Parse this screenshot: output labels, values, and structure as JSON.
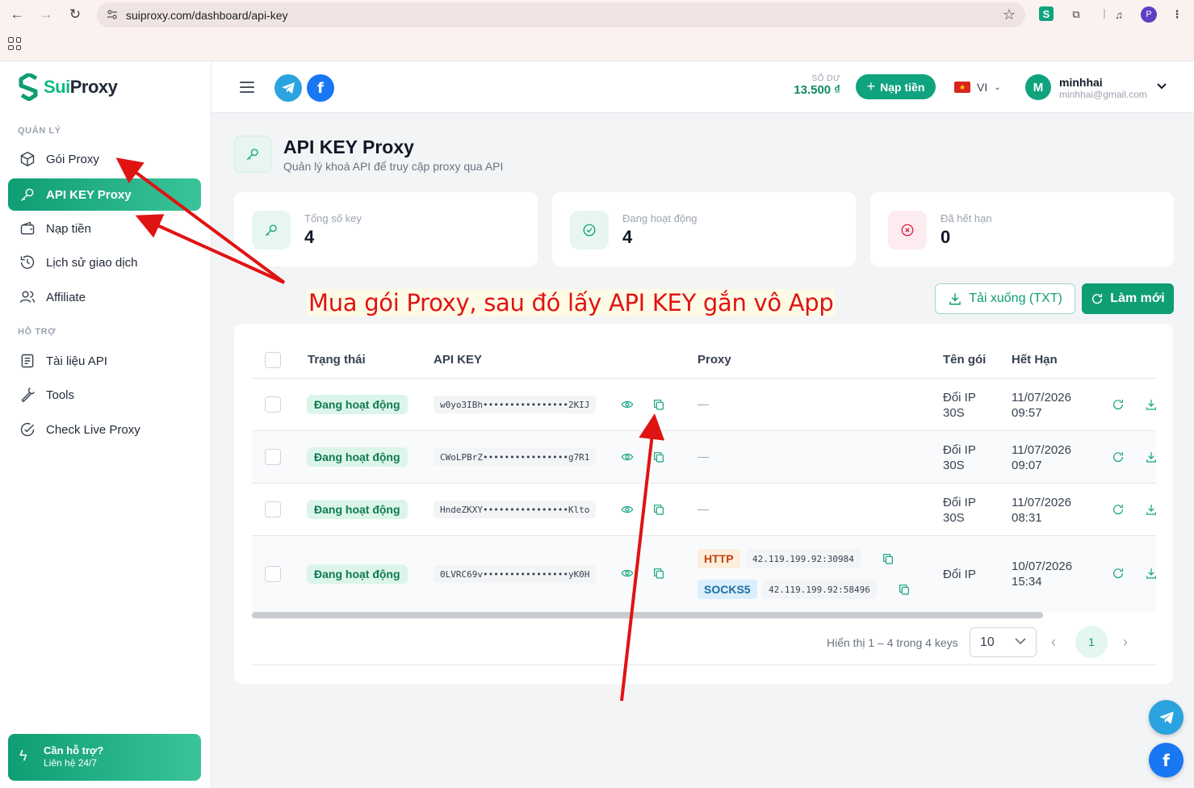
{
  "browser": {
    "url": "suiproxy.com/dashboard/api-key",
    "profile_initial": "P"
  },
  "sidebar": {
    "logo_part1": "Sui",
    "logo_part2": "Proxy",
    "section_manage": "QUẢN LÝ",
    "section_support": "HỖ TRỢ",
    "items": [
      {
        "label": "Gói Proxy",
        "icon": "box-icon"
      },
      {
        "label": "API KEY Proxy",
        "icon": "key-icon"
      },
      {
        "label": "Nạp tiền",
        "icon": "wallet-icon"
      },
      {
        "label": "Lịch sử giao dịch",
        "icon": "history-icon"
      },
      {
        "label": "Affiliate",
        "icon": "users-icon"
      },
      {
        "label": "Tài liệu API",
        "icon": "doc-icon"
      },
      {
        "label": "Tools",
        "icon": "wrench-icon"
      },
      {
        "label": "Check Live Proxy",
        "icon": "check-circle-icon"
      }
    ],
    "support_title": "Cần hỗ trợ?",
    "support_sub": "Liên hệ 24/7"
  },
  "header": {
    "balance_label": "SỐ DƯ",
    "balance_value": "13.500 ₫",
    "deposit_label": "Nạp tiền",
    "lang": "VI",
    "user_initial": "M",
    "user_name": "minhhai",
    "user_email": "minhhai@gmail.com"
  },
  "page": {
    "title": "API KEY Proxy",
    "subtitle": "Quản lý khoá API để truy cập proxy qua API"
  },
  "stats": [
    {
      "label": "Tổng số key",
      "value": "4",
      "color": "#10a37f"
    },
    {
      "label": "Đang hoạt động",
      "value": "4",
      "color": "#10a37f"
    },
    {
      "label": "Đã hết hạn",
      "value": "0",
      "color": "#e11d48"
    }
  ],
  "annotation": "Mua gói Proxy, sau đó lấy API KEY gắn vô App",
  "actions": {
    "download": "Tải xuống (TXT)",
    "refresh": "Làm mới"
  },
  "table": {
    "columns": [
      "Trạng thái",
      "API KEY",
      "Proxy",
      "Tên gói",
      "Hết Hạn"
    ],
    "rows": [
      {
        "status": "Đang hoạt động",
        "key": "w0yo3IBh••••••••••••••••2KIJ",
        "proxy": "—",
        "package": "Đổi IP 30S",
        "expires": "11/07/2026 09:57"
      },
      {
        "status": "Đang hoạt động",
        "key": "CWoLPBrZ••••••••••••••••g7R1",
        "proxy": "—",
        "package": "Đổi IP 30S",
        "expires": "11/07/2026 09:07"
      },
      {
        "status": "Đang hoạt động",
        "key": "HndeZKXY••••••••••••••••Klto",
        "proxy": "—",
        "package": "Đổi IP 30S",
        "expires": "11/07/2026 08:31"
      },
      {
        "status": "Đang hoạt động",
        "key": "0LVRC69v••••••••••••••••yK0H",
        "proxies": [
          {
            "type": "HTTP",
            "addr": "42.119.199.92:30984"
          },
          {
            "type": "SOCKS5",
            "addr": "42.119.199.92:58496"
          }
        ],
        "package": "Đổi IP",
        "expires": "10/07/2026 15:34"
      }
    ]
  },
  "pagination": {
    "summary": "Hiển thị 1 – 4 trong 4 keys",
    "page_size": "10",
    "current_page": "1"
  },
  "colors": {
    "accent": "#10a37f",
    "annotation": "#e01313"
  }
}
